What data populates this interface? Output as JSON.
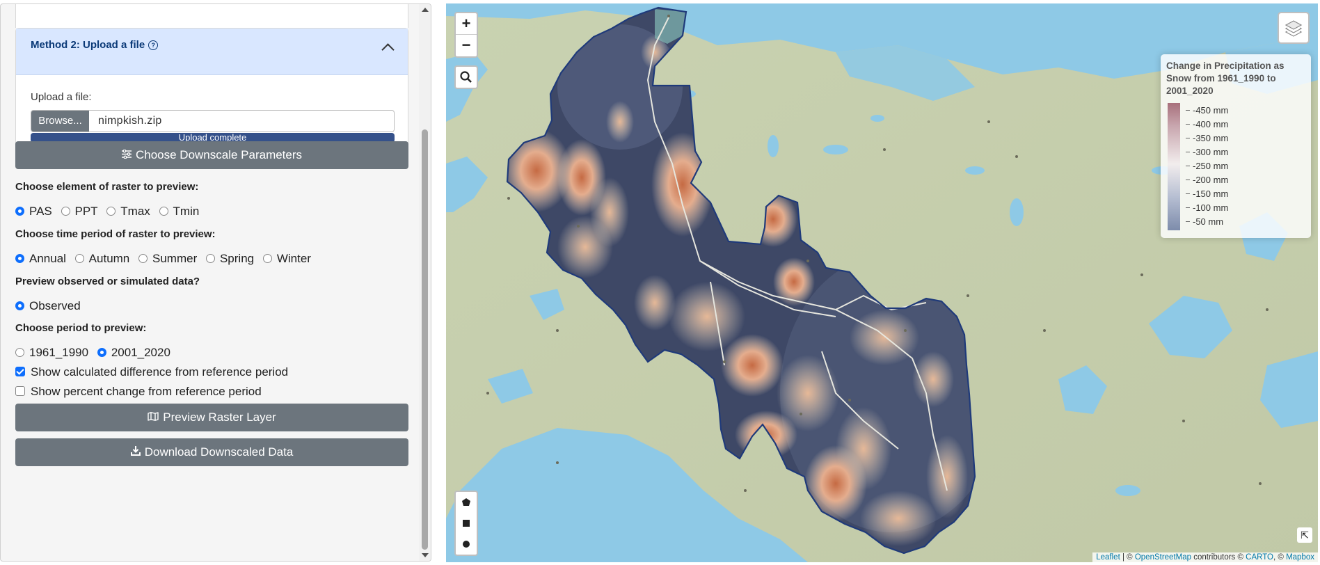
{
  "sidebar": {
    "accordion": {
      "title": "Method 2: Upload a file",
      "help_icon": "?",
      "upload_label": "Upload a file:",
      "browse_label": "Browse...",
      "file_name": "nimpkish.zip",
      "progress_text": "Upload complete",
      "progress": 1.0
    },
    "choose_params_button": "Choose Downscale Parameters",
    "element_question": "Choose element of raster to preview:",
    "element_options": [
      "PAS",
      "PPT",
      "Tmax",
      "Tmin"
    ],
    "element_selected": "PAS",
    "time_question": "Choose time period of raster to preview:",
    "time_options": [
      "Annual",
      "Autumn",
      "Summer",
      "Spring",
      "Winter"
    ],
    "time_selected": "Annual",
    "data_question": "Preview observed or simulated data?",
    "data_options": [
      "Observed"
    ],
    "data_selected": "Observed",
    "period_question": "Choose period to preview:",
    "period_options": [
      "1961_1990",
      "2001_2020"
    ],
    "period_selected": "2001_2020",
    "checkbox_difference": "Show calculated difference from reference period",
    "checkbox_difference_checked": true,
    "checkbox_percent": "Show percent change from reference period",
    "checkbox_percent_checked": false,
    "preview_button": "Preview Raster Layer",
    "download_button": "Download Downscaled Data"
  },
  "map": {
    "zoom_in": "+",
    "zoom_out": "−",
    "legend": {
      "title": "Change in Precipitation as Snow from 1961_1990 to 2001_2020",
      "labels": [
        "-450 mm",
        "-400 mm",
        "-350 mm",
        "-300 mm",
        "-250 mm",
        "-200 mm",
        "-150 mm",
        "-100 mm",
        "-50 mm"
      ]
    },
    "attribution": {
      "leaflet": "Leaflet",
      "sep1": " | © ",
      "osm": "OpenStreetMap",
      "contrib": " contributors © ",
      "carto": "CARTO",
      "sep2": ", © ",
      "mapbox": "Mapbox"
    },
    "colors": {
      "water": "#8ec9e6",
      "land": "#c5cfae",
      "boundary": "#1f3a7a",
      "high_loss": "#c0683f",
      "low_loss": "#3d4763"
    }
  }
}
